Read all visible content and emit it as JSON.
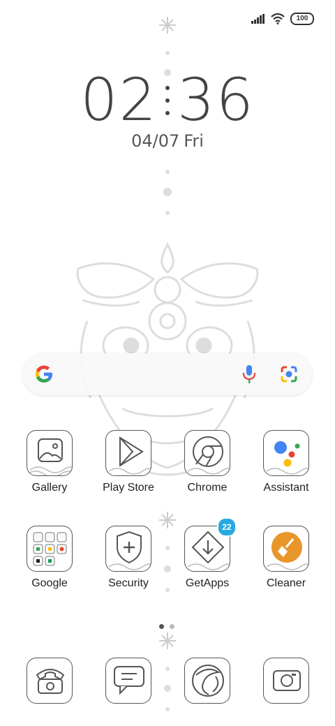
{
  "status_bar": {
    "battery": "100",
    "icons": [
      "signal-icon",
      "wifi-icon",
      "battery-icon"
    ]
  },
  "clock": {
    "hours": "02",
    "minutes": "36"
  },
  "date": {
    "date": "04/07",
    "day": "Fri"
  },
  "search_bar": {
    "icons": [
      "google-logo-icon",
      "microphone-icon",
      "google-lens-icon"
    ]
  },
  "apps": [
    {
      "label": "Gallery",
      "icon": "gallery-icon"
    },
    {
      "label": "Play Store",
      "icon": "play-store-icon"
    },
    {
      "label": "Chrome",
      "icon": "chrome-icon"
    },
    {
      "label": "Assistant",
      "icon": "assistant-icon"
    },
    {
      "label": "Google",
      "icon": "folder-icon"
    },
    {
      "label": "Security",
      "icon": "security-icon"
    },
    {
      "label": "GetApps",
      "icon": "getapps-icon",
      "badge": "22"
    },
    {
      "label": "Cleaner",
      "icon": "cleaner-icon"
    }
  ],
  "dock": [
    {
      "icon": "phone-icon"
    },
    {
      "icon": "messages-icon"
    },
    {
      "icon": "browser-icon"
    },
    {
      "icon": "camera-icon"
    }
  ],
  "colors": {
    "badge": "#27a9e1",
    "cleaner": "#e8952a",
    "text": "#222222"
  }
}
